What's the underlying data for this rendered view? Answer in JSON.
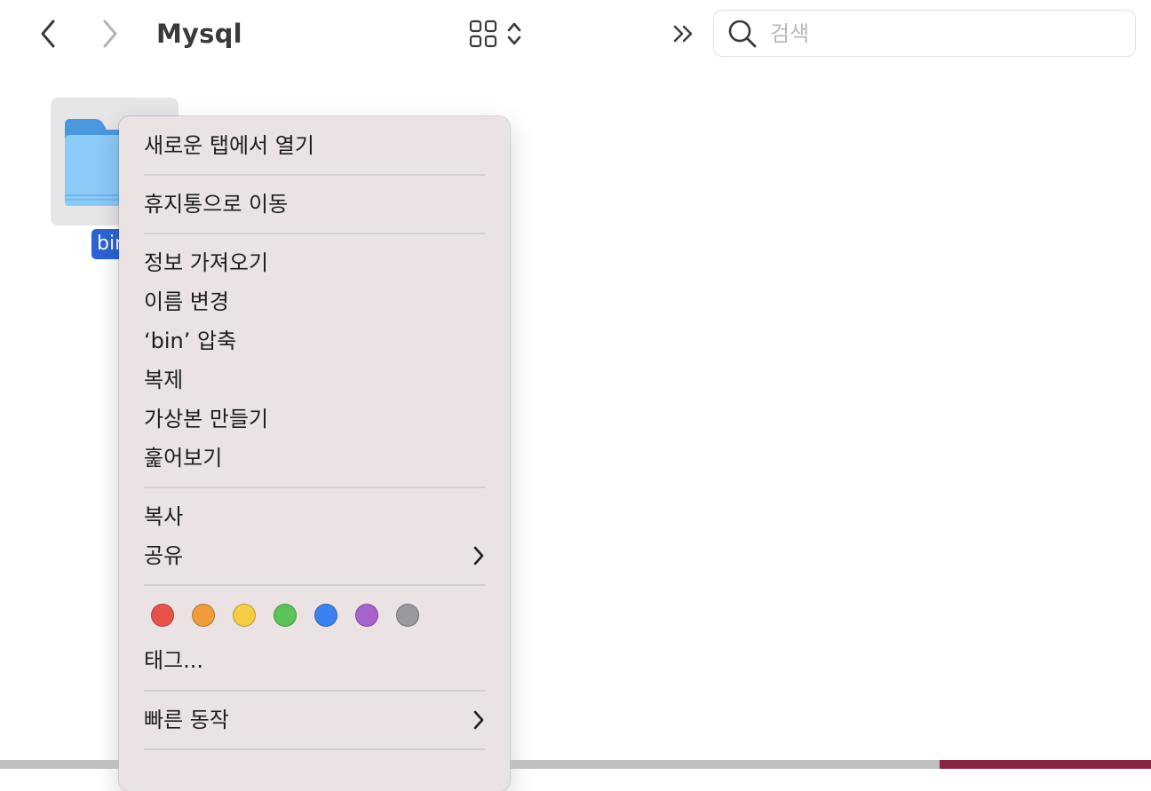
{
  "toolbar": {
    "title": "Mysql",
    "search_placeholder": "검색"
  },
  "file": {
    "name": "bin"
  },
  "menu": {
    "group1": [
      {
        "label": "새로운 탭에서 열기"
      }
    ],
    "group2": [
      {
        "label": "휴지통으로 이동"
      }
    ],
    "group3": [
      {
        "label": "정보 가져오기"
      },
      {
        "label": "이름 변경"
      },
      {
        "label": "‘bin’ 압축"
      },
      {
        "label": "복제"
      },
      {
        "label": "가상본 만들기"
      },
      {
        "label": "훑어보기"
      }
    ],
    "group4": [
      {
        "label": "복사"
      },
      {
        "label": "공유",
        "has_submenu": true
      }
    ],
    "tags_label": "태그...",
    "tag_colors": [
      {
        "name": "red",
        "hex": "#e9524a"
      },
      {
        "name": "orange",
        "hex": "#f09c3d"
      },
      {
        "name": "yellow",
        "hex": "#f5cd42"
      },
      {
        "name": "green",
        "hex": "#5cc35a"
      },
      {
        "name": "blue",
        "hex": "#3d80f0"
      },
      {
        "name": "purple",
        "hex": "#a763cc"
      },
      {
        "name": "gray",
        "hex": "#98989d"
      }
    ],
    "group6": [
      {
        "label": "빠른 동작",
        "has_submenu": true
      }
    ]
  },
  "colors": {
    "selection": "#2c63d6",
    "menu_bg": "#ebe3e3",
    "folder": "#5aaaf0"
  }
}
